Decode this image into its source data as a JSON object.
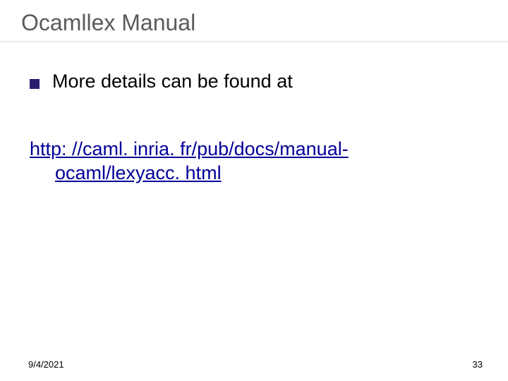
{
  "title": "Ocamllex Manual",
  "bullet": {
    "text": "More details can be found at"
  },
  "link": {
    "line1": "http: //caml. inria. fr/pub/docs/manual-",
    "line2": "ocaml/lexyacc. html"
  },
  "footer": {
    "date": "9/4/2021",
    "page": "33"
  }
}
